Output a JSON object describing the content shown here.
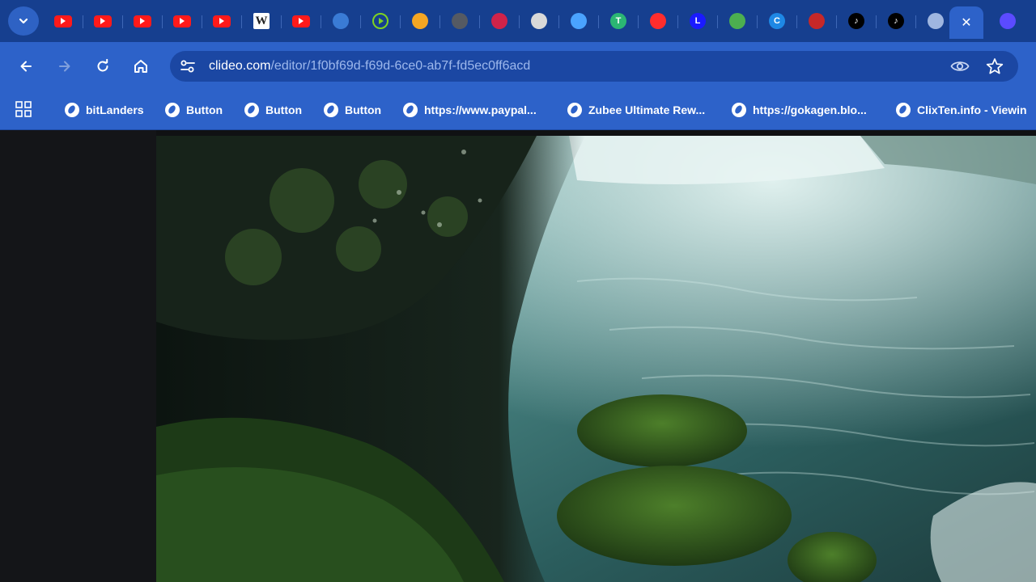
{
  "browser": {
    "active_tab": {
      "close_label": "✕"
    },
    "tabs": [
      {
        "icon": "youtube-icon",
        "color": "#ff1a1a"
      },
      {
        "icon": "youtube-icon",
        "color": "#ff1a1a"
      },
      {
        "icon": "youtube-icon",
        "color": "#ff1a1a"
      },
      {
        "icon": "youtube-icon",
        "color": "#ff1a1a"
      },
      {
        "icon": "youtube-icon",
        "color": "#ff1a1a"
      },
      {
        "icon": "wikipedia-icon",
        "glyph": "W"
      },
      {
        "icon": "youtube-icon",
        "color": "#ff1a1a"
      },
      {
        "icon": "site-icon",
        "color": "#3a7bd5"
      },
      {
        "icon": "play-icon",
        "color": "#7ed321"
      },
      {
        "icon": "site-icon",
        "color": "#f5a623"
      },
      {
        "icon": "site-icon",
        "color": "#555a63"
      },
      {
        "icon": "site-icon",
        "color": "#d0234a"
      },
      {
        "icon": "site-icon",
        "color": "#d9d9d9"
      },
      {
        "icon": "site-icon",
        "color": "#4aa3ff"
      },
      {
        "icon": "site-icon",
        "color": "#2bb673",
        "glyph": "T"
      },
      {
        "icon": "site-icon",
        "color": "#ff2d2d"
      },
      {
        "icon": "site-icon",
        "color": "#1a1aff",
        "glyph": "L"
      },
      {
        "icon": "site-icon",
        "color": "#4caf50"
      },
      {
        "icon": "site-icon",
        "color": "#1e88e5",
        "glyph": "C"
      },
      {
        "icon": "site-icon",
        "color": "#c62828"
      },
      {
        "icon": "tiktok-icon",
        "color": "#000000",
        "glyph": "♪"
      },
      {
        "icon": "tiktok-icon",
        "color": "#000000",
        "glyph": "♪"
      },
      {
        "icon": "site-icon",
        "color": "#9fb6e0"
      }
    ],
    "after_active_tab_icon": {
      "icon": "site-icon",
      "color": "#5b4bff"
    },
    "address_bar": {
      "host": "clideo.com",
      "path": "/editor/1f0bf69d-f69d-6ce0-ab7f-fd5ec0ff6acd"
    },
    "bookmarks": [
      {
        "label": "bitLanders"
      },
      {
        "label": "Button"
      },
      {
        "label": "Button"
      },
      {
        "label": "Button"
      },
      {
        "label": "https://www.paypal..."
      },
      {
        "label": "Zubee Ultimate Rew..."
      },
      {
        "label": "https://gokagen.blo..."
      },
      {
        "label": "ClixTen.info - Viewin"
      }
    ]
  },
  "colors": {
    "tabstrip": "#163f8f",
    "toolbar": "#2d62c9",
    "omnibox": "#1b47a3"
  },
  "content": {
    "video_description_visible": false
  }
}
